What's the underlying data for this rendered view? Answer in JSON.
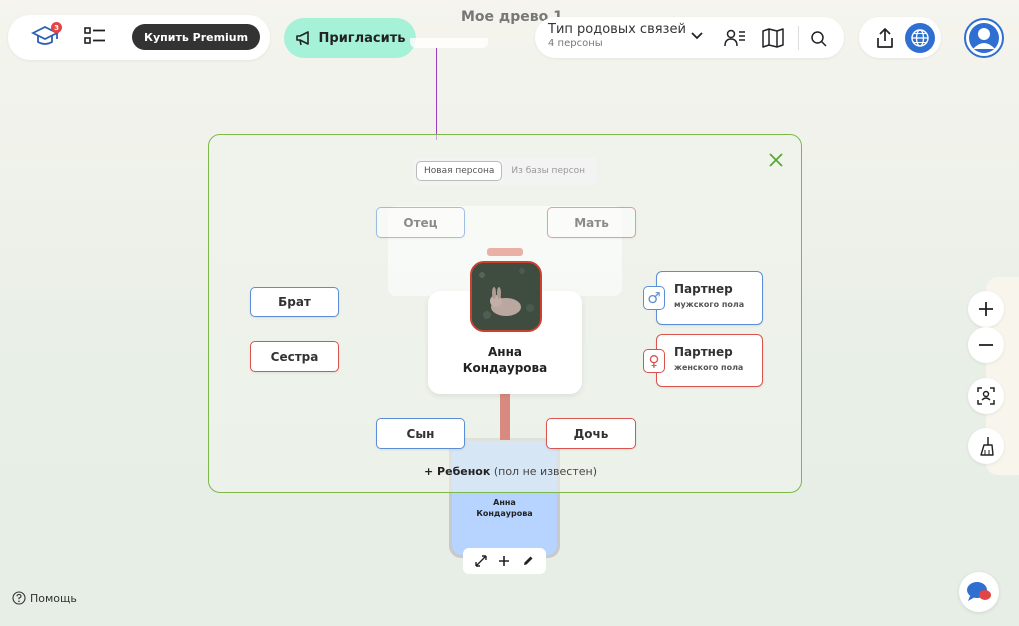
{
  "header": {
    "notification_count": "3",
    "premium_label": "Купить Premium",
    "invite_label": "Пригласить",
    "tree_title": "Мое древо 1",
    "relation_type_label": "Тип родовых связей",
    "persons_count": "4 персоны"
  },
  "panel": {
    "tabs": [
      {
        "label": "Новая персона",
        "active": true
      },
      {
        "label": "Из базы персон",
        "active": false
      }
    ],
    "father_label": "Отец",
    "mother_label": "Мать",
    "brother_label": "Брат",
    "sister_label": "Сестра",
    "son_label": "Сын",
    "daughter_label": "Дочь",
    "partner_male": {
      "title": "Партнер",
      "subtitle": "мужского пола"
    },
    "partner_female": {
      "title": "Партнер",
      "subtitle": "женского пола"
    },
    "add_child_bold": "+ Ребенок",
    "add_child_note": "(пол не известен)"
  },
  "person": {
    "first_name": "Анна",
    "last_name": "Кондаурова"
  },
  "background_card": {
    "first_name": "Анна",
    "last_name": "Кондаурова"
  },
  "footer": {
    "help_label": "Помощь"
  },
  "colors": {
    "male": "#5b8ed6",
    "female": "#d9534f",
    "panel_border": "#7cb84a",
    "invite_bg": "#a6f2d8"
  }
}
